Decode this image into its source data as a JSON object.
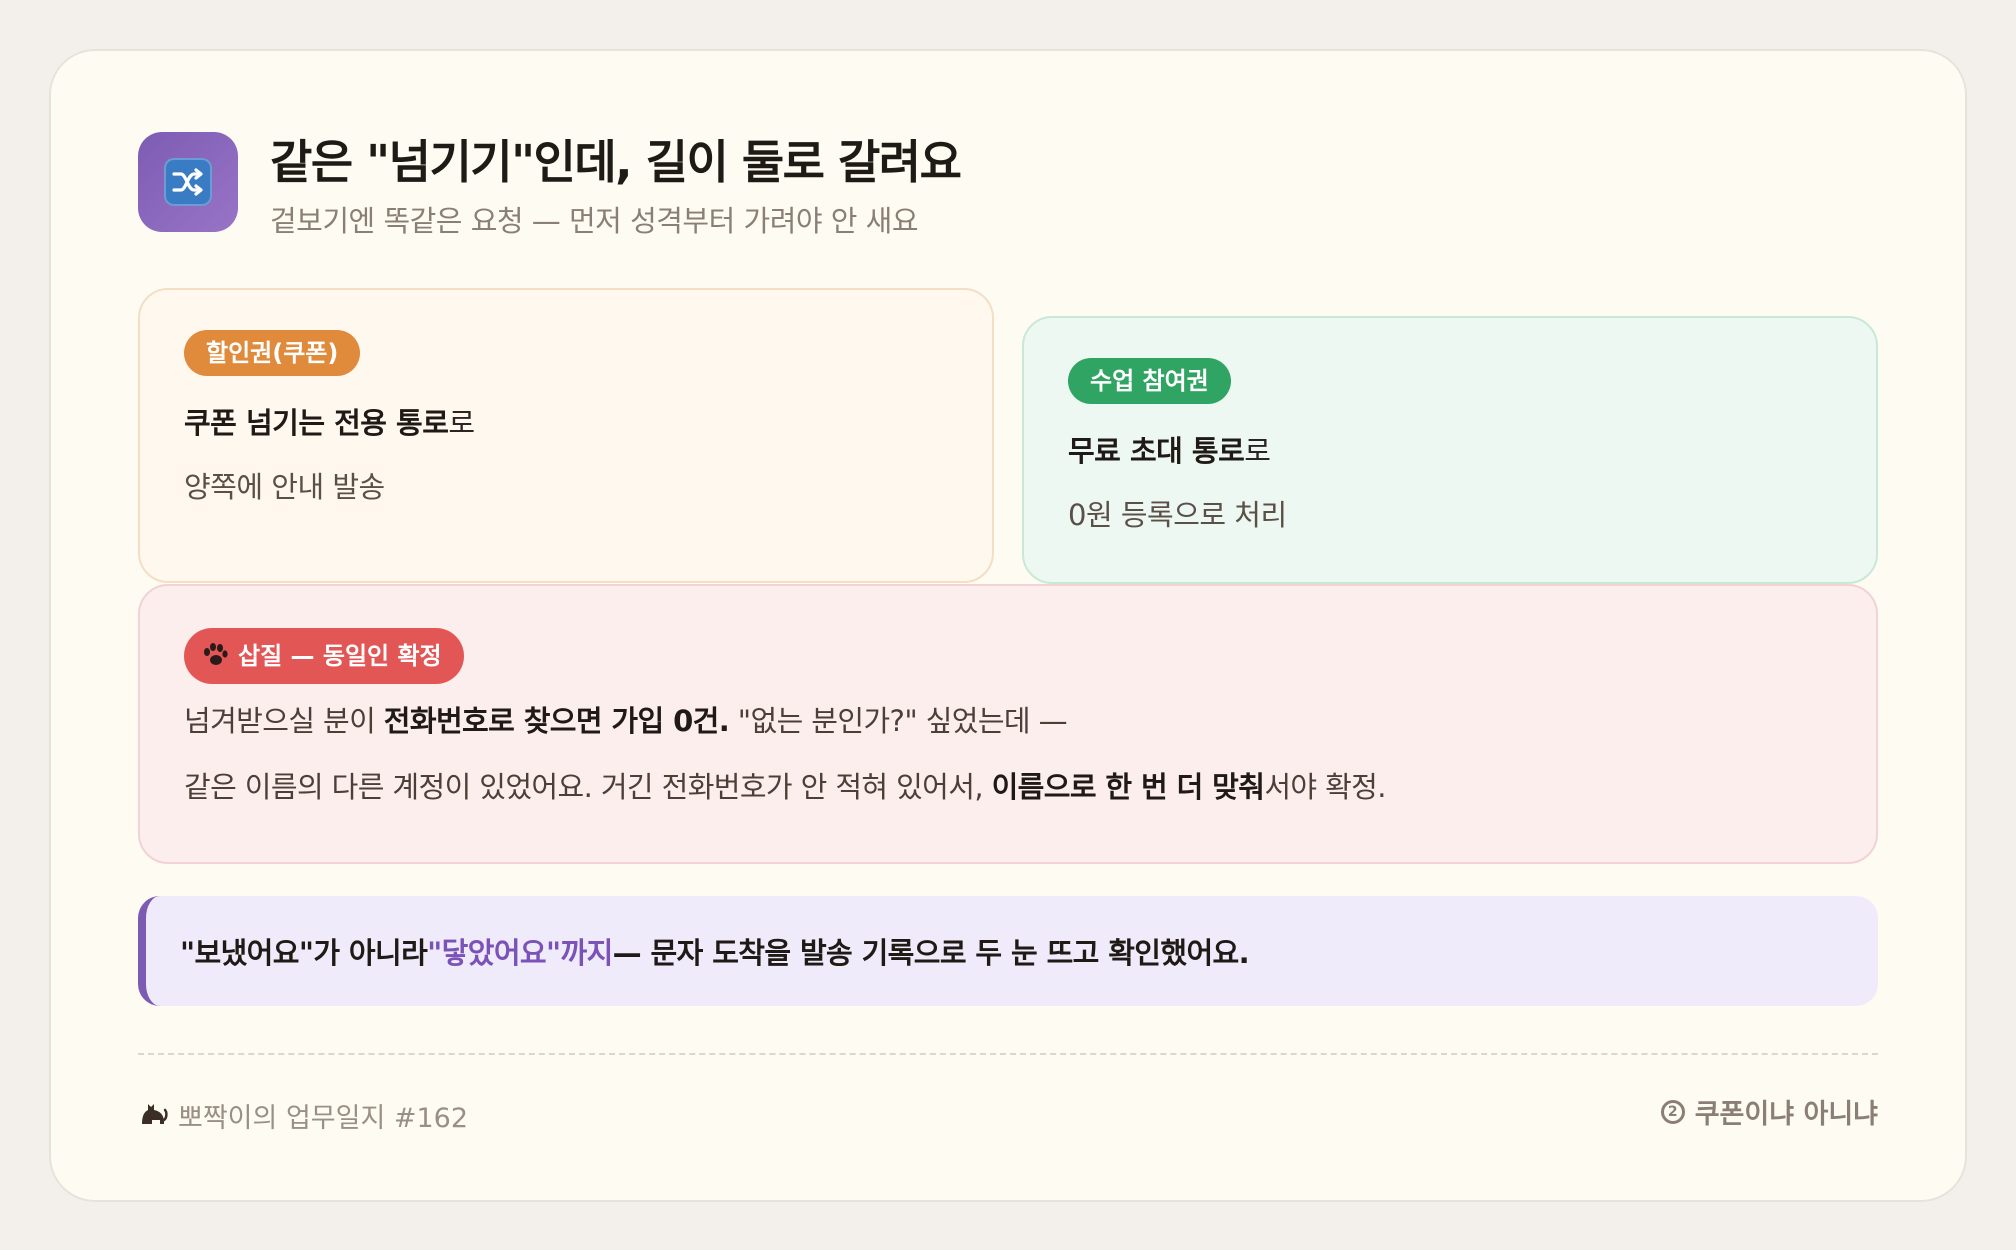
{
  "header": {
    "icon": "shuffle-icon",
    "title": "같은 \"넘기기\"인데, 길이 둘로 갈려요",
    "subtitle": "겉보기엔 똑같은 요청 — 먼저 성격부터 가려야 안 새요"
  },
  "coupon_box": {
    "badge": "할인권(쿠폰)",
    "line1_bold": "쿠폰 넘기는 전용 통로",
    "line1_rest": "로",
    "line2": "양쪽에 안내 발송"
  },
  "class_box": {
    "badge": "수업 참여권",
    "line1_bold": "무료 초대 통로",
    "line1_rest": "로",
    "line2": "0원 등록으로 처리"
  },
  "dig_box": {
    "badge_icon": "paw-icon",
    "badge": "삽질 — 동일인 확정",
    "line1_a": "넘겨받으실 분이 ",
    "line1_bold": "전화번호로 찾으면 가입 0건.",
    "line1_b": " \"없는 분인가?\" 싶었는데 —",
    "line2_a": "같은 이름의 다른 계정이 있었어요. 거긴 전화번호가 안 적혀 있어서, ",
    "line2_bold": "이름으로 한 번 더 맞춰",
    "line2_b": "서야 확정."
  },
  "note": {
    "part1": "\"보냈어요\"가 아니라 ",
    "highlight": "\"닿았어요\"까지",
    "part2": " — 문자 도착을 발송 기록으로 두 눈 뜨고 확인했어요."
  },
  "footer": {
    "left_icon": "cat-icon",
    "left_text": "뽀짝이의 업무일지 #162",
    "right_number": "2",
    "right_text": "쿠폰이냐 아니냐"
  },
  "colors": {
    "accent_purple": "#7c5cb3",
    "badge_orange": "#e08a3c",
    "badge_green": "#2fa463",
    "badge_red": "#e35656"
  }
}
